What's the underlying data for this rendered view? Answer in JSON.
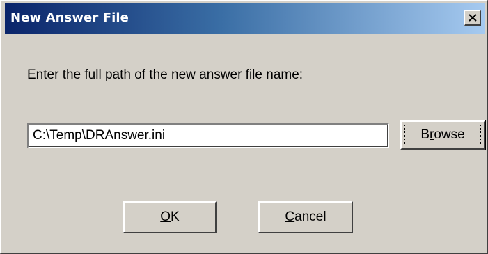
{
  "window": {
    "title": "New Answer File",
    "close_symbol": "×"
  },
  "prompt": {
    "text": "Enter the full path of the new answer file name:"
  },
  "path_field": {
    "value": "C:\\Temp\\DRAnswer.ini"
  },
  "buttons": {
    "browse": {
      "pre": "B",
      "accel": "r",
      "post": "owse"
    },
    "ok": {
      "pre": "",
      "accel": "O",
      "post": "K"
    },
    "cancel": {
      "pre": "",
      "accel": "C",
      "post": "ancel"
    }
  },
  "colors": {
    "title_gradient_start": "#0a246a",
    "title_gradient_end": "#a6caf0",
    "dialog_face": "#d4d0c8"
  },
  "icons": {
    "close": "close-icon"
  }
}
